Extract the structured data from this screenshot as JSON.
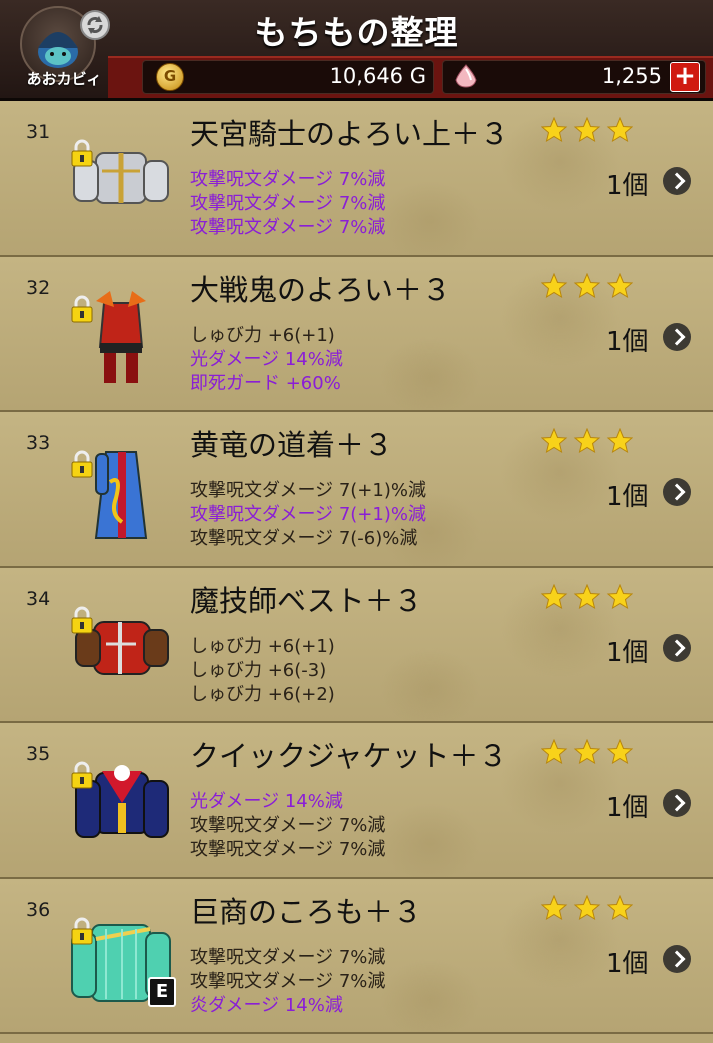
{
  "header": {
    "title": "もちもの整理",
    "user_name": "あおカビィ",
    "gold": "10,646 G",
    "gems": "1,255",
    "plus_label": "+"
  },
  "colors": {
    "purple_stat": "#8a1ed6",
    "header_red": "#6b1410"
  },
  "items": [
    {
      "num": "31",
      "name": "天宮騎士のよろい上＋３",
      "stars": 3,
      "count": "1個",
      "equipped": false,
      "armor": "silver-plate",
      "stats": [
        {
          "text": "攻撃呪文ダメージ 7%減",
          "color": "purple"
        },
        {
          "text": "攻撃呪文ダメージ 7%減",
          "color": "purple"
        },
        {
          "text": "攻撃呪文ダメージ 7%減",
          "color": "purple"
        }
      ]
    },
    {
      "num": "32",
      "name": "大戦鬼のよろい＋３",
      "stars": 3,
      "count": "1個",
      "equipped": false,
      "armor": "red-demon",
      "stats": [
        {
          "text": "しゅび力 +6(+1)",
          "color": "black"
        },
        {
          "text": "光ダメージ 14%減",
          "color": "purple"
        },
        {
          "text": "即死ガード +60%",
          "color": "purple"
        }
      ]
    },
    {
      "num": "33",
      "name": "黄竜の道着＋３",
      "stars": 3,
      "count": "1個",
      "equipped": false,
      "armor": "blue-robe",
      "stats": [
        {
          "text": "攻撃呪文ダメージ 7(+1)%減",
          "color": "black"
        },
        {
          "text": "攻撃呪文ダメージ 7(+1)%減",
          "color": "purple"
        },
        {
          "text": "攻撃呪文ダメージ 7(-6)%減",
          "color": "black"
        }
      ]
    },
    {
      "num": "34",
      "name": "魔技師ベスト＋３",
      "stars": 3,
      "count": "1個",
      "equipped": false,
      "armor": "red-vest",
      "stats": [
        {
          "text": "しゅび力 +6(+1)",
          "color": "black"
        },
        {
          "text": "しゅび力 +6(-3)",
          "color": "black"
        },
        {
          "text": "しゅび力 +6(+2)",
          "color": "black"
        }
      ]
    },
    {
      "num": "35",
      "name": "クイックジャケット＋３",
      "stars": 3,
      "count": "1個",
      "equipped": false,
      "armor": "navy-jacket",
      "stats": [
        {
          "text": "光ダメージ 14%減",
          "color": "purple"
        },
        {
          "text": "攻撃呪文ダメージ 7%減",
          "color": "black"
        },
        {
          "text": "攻撃呪文ダメージ 7%減",
          "color": "black"
        }
      ]
    },
    {
      "num": "36",
      "name": "巨商のころも＋３",
      "stars": 3,
      "count": "1個",
      "equipped": true,
      "equip_label": "E",
      "armor": "green-robe",
      "stats": [
        {
          "text": "攻撃呪文ダメージ 7%減",
          "color": "black"
        },
        {
          "text": "攻撃呪文ダメージ 7%減",
          "color": "black"
        },
        {
          "text": "炎ダメージ 14%減",
          "color": "purple"
        }
      ]
    }
  ]
}
